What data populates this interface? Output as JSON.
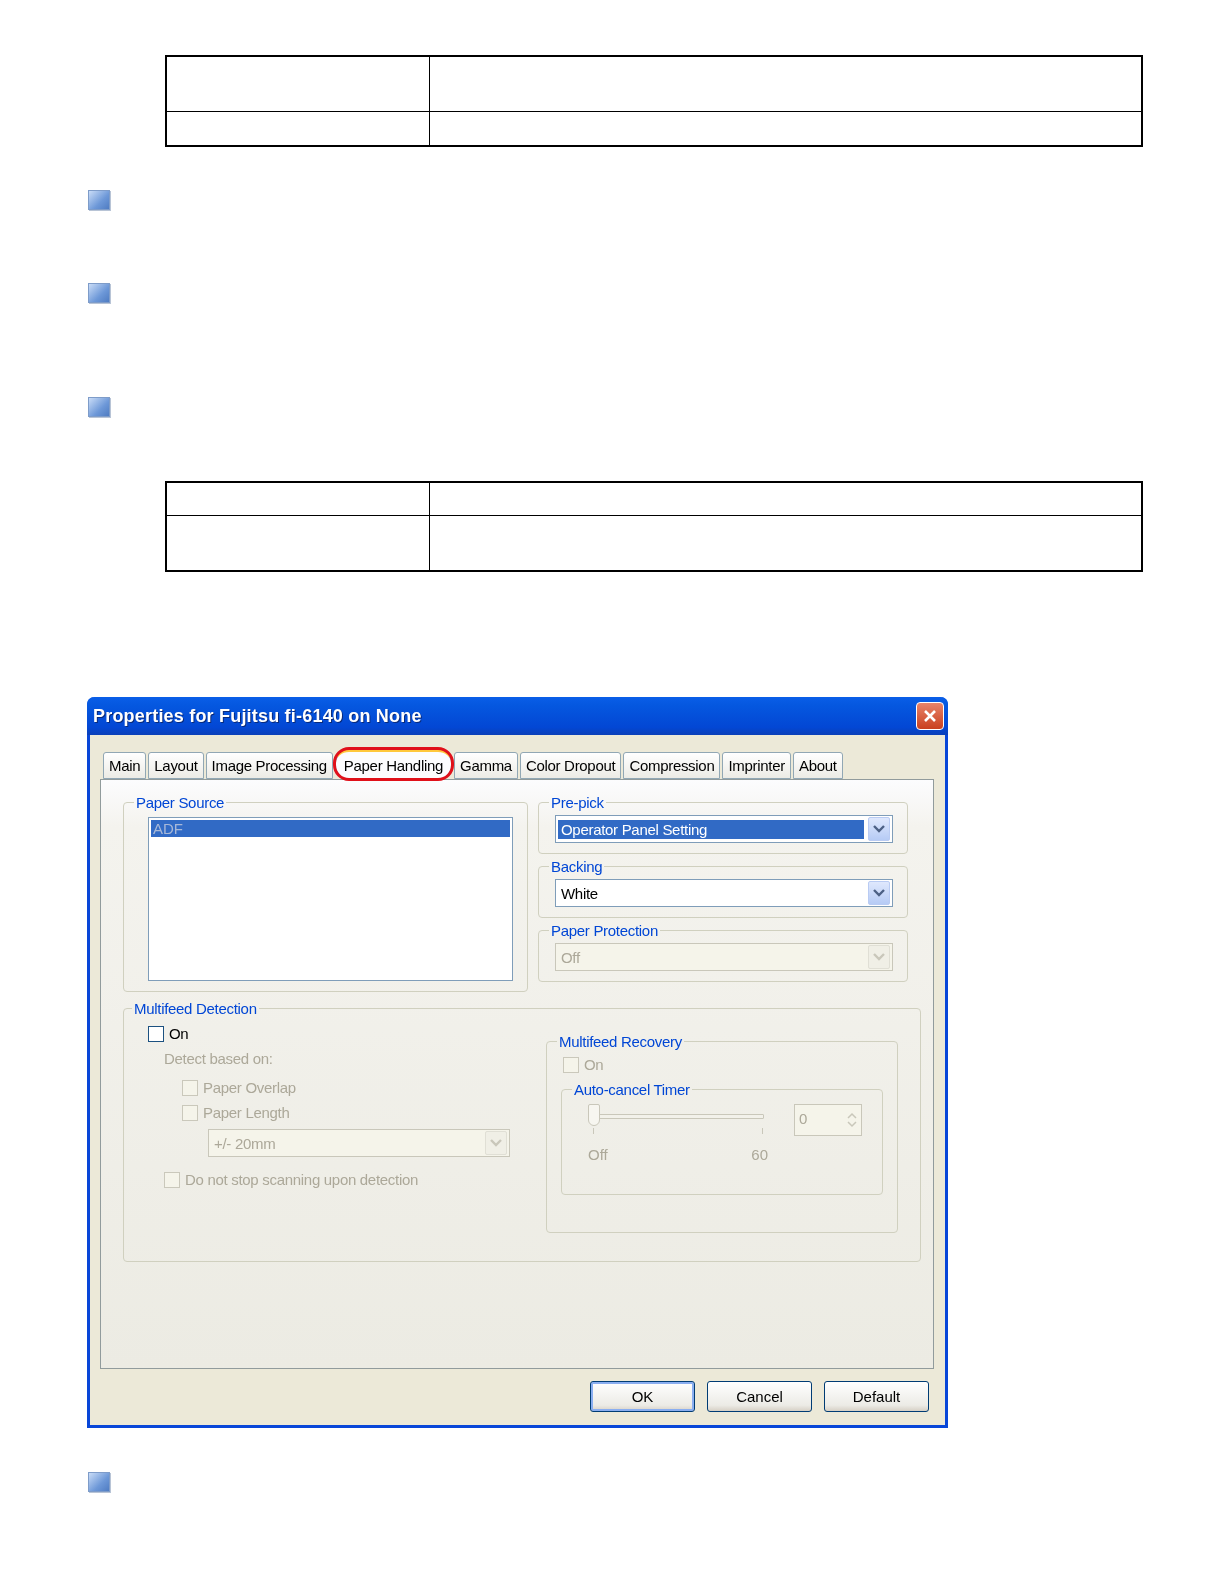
{
  "window": {
    "title": "Properties for Fujitsu fi-6140 on None"
  },
  "tabs": [
    {
      "label": "Main",
      "selected": false,
      "circled": false
    },
    {
      "label": "Layout",
      "selected": false,
      "circled": false
    },
    {
      "label": "Image Processing",
      "selected": false,
      "circled": false
    },
    {
      "label": "Paper Handling",
      "selected": true,
      "circled": true
    },
    {
      "label": "Gamma",
      "selected": false,
      "circled": false
    },
    {
      "label": "Color Dropout",
      "selected": false,
      "circled": false
    },
    {
      "label": "Compression",
      "selected": false,
      "circled": false
    },
    {
      "label": "Imprinter",
      "selected": false,
      "circled": false
    },
    {
      "label": "About",
      "selected": false,
      "circled": false
    }
  ],
  "paper_source": {
    "title": "Paper Source",
    "disabled": true,
    "items": [
      {
        "label": "ADF",
        "selected": true
      }
    ]
  },
  "dropdowns": [
    {
      "title": "Pre-pick",
      "value": "Operator Panel Setting",
      "focused": true,
      "disabled": false
    },
    {
      "title": "Backing",
      "value": "White",
      "focused": false,
      "disabled": false
    },
    {
      "title": "Paper Protection",
      "value": "Off",
      "focused": false,
      "disabled": true
    }
  ],
  "multifeed_detection": {
    "title": "Multifeed Detection",
    "on": {
      "label": "On",
      "checked": false,
      "disabled": false
    },
    "detect_label": "Detect based on:",
    "options": [
      {
        "label": "Paper Overlap",
        "checked": false,
        "disabled": true
      },
      {
        "label": "Paper Length",
        "checked": false,
        "disabled": true
      }
    ],
    "length_select": {
      "value": "+/- 20mm",
      "disabled": true
    },
    "no_stop": {
      "label": "Do not stop scanning upon detection",
      "checked": false,
      "disabled": true
    }
  },
  "multifeed_recovery": {
    "title": "Multifeed Recovery",
    "on": {
      "label": "On",
      "checked": false,
      "disabled": true
    },
    "timer": {
      "title": "Auto-cancel Timer",
      "level": 0,
      "min_label": "Off",
      "max_label": "60",
      "spin_value": "0",
      "disabled": true
    }
  },
  "buttons": [
    {
      "label": "OK",
      "default": true
    },
    {
      "label": "Cancel",
      "default": false
    },
    {
      "label": "Default",
      "default": false
    }
  ]
}
